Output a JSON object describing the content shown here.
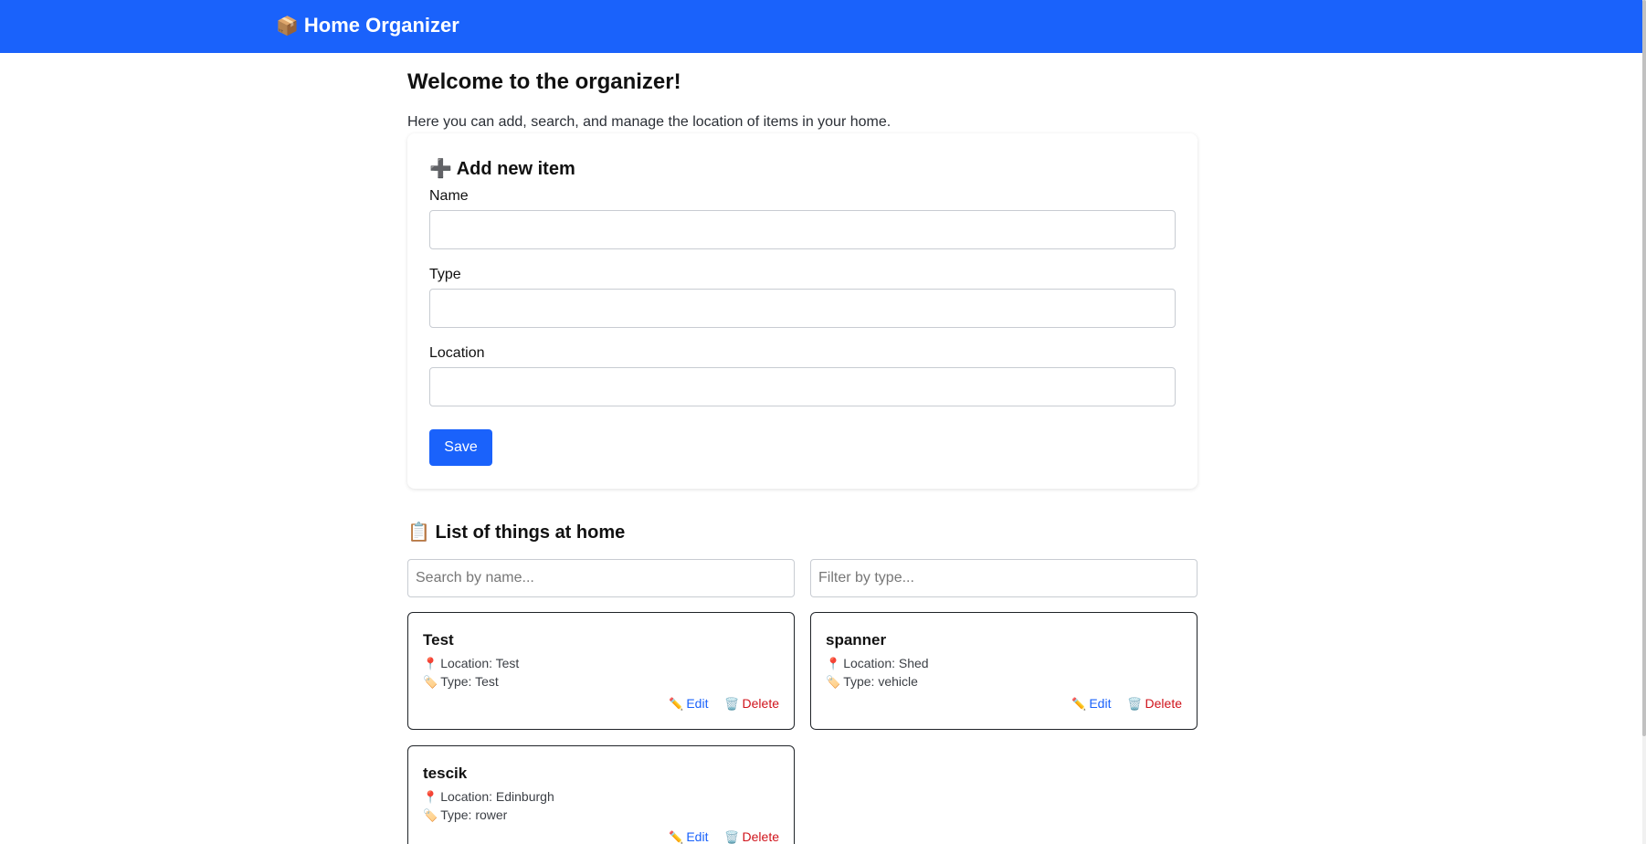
{
  "header": {
    "brand_icon": "📦",
    "brand": "Home Organizer",
    "color": "#1a62fb"
  },
  "main": {
    "welcome": "Welcome to the organizer!",
    "intro": "Here you can add, search, and manage the location of items in your home."
  },
  "form": {
    "icon": "➕",
    "title": "Add new item",
    "name_label": "Name",
    "name_value": "",
    "type_label": "Type",
    "type_value": "",
    "location_label": "Location",
    "location_value": "",
    "save_label": "Save"
  },
  "list": {
    "icon": "📋",
    "title": "List of things at home",
    "search_placeholder": "Search by name...",
    "filter_placeholder": "Filter by type...",
    "location_icon": "📍",
    "type_icon": "🏷️",
    "edit_icon": "✏️",
    "delete_icon": "🗑️",
    "edit_label": "Edit",
    "delete_label": "Delete",
    "items": [
      {
        "name": "Test",
        "location": "Location: Test",
        "type": "Type: Test"
      },
      {
        "name": "spanner",
        "location": "Location: Shed",
        "type": "Type: vehicle"
      },
      {
        "name": "tescik",
        "location": "Location: Edinburgh",
        "type": "Type: rower"
      }
    ]
  }
}
